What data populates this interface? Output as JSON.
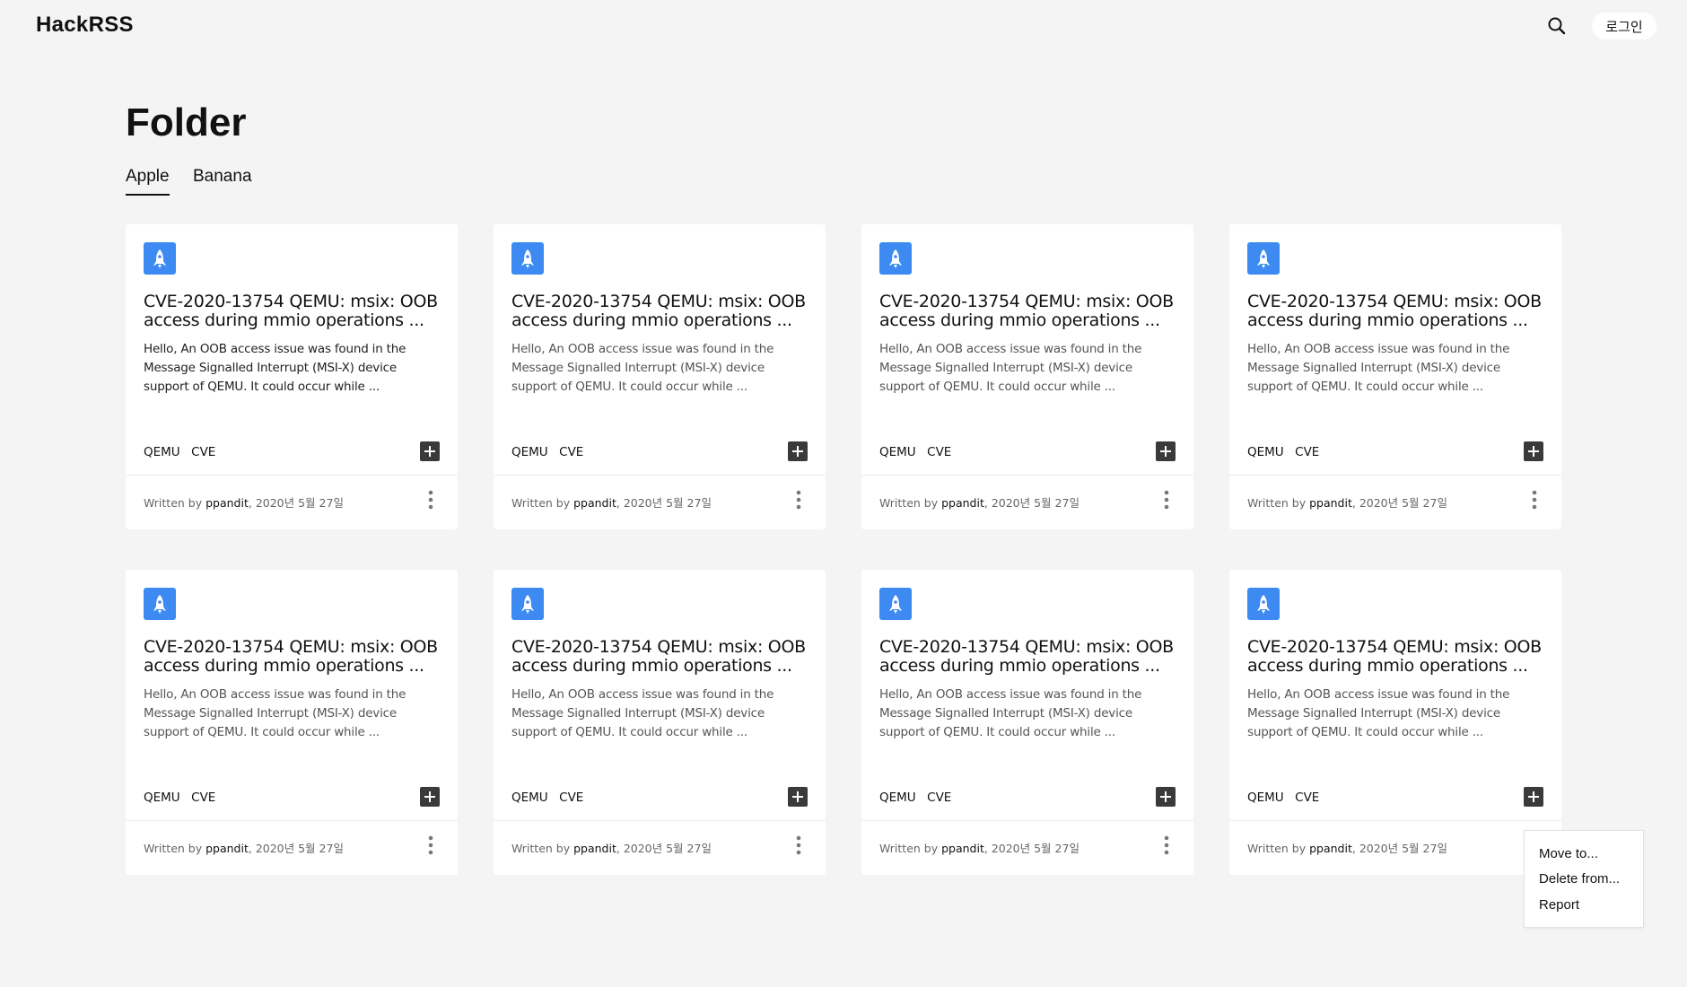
{
  "app": {
    "name": "HackRSS"
  },
  "header": {
    "login_label": "로그인"
  },
  "page": {
    "title": "Folder"
  },
  "tabs": [
    {
      "label": "Apple",
      "active": true
    },
    {
      "label": "Banana",
      "active": false
    }
  ],
  "cards": [
    {
      "title": "CVE-2020-13754 QEMU: msix: OOB access during mmio operations ...",
      "desc": "Hello, An OOB access issue was found in the Message Signalled Interrupt (MSI-X) device support of QEMU. It could occur while ...",
      "tags": [
        "QEMU",
        "CVE"
      ],
      "written_by": "Written by ",
      "author": "ppandit",
      "date": ", 2020년 5월 27일"
    },
    {
      "title": "CVE-2020-13754 QEMU: msix: OOB access during mmio operations ...",
      "desc": "Hello, An OOB access issue was found in the Message Signalled Interrupt (MSI-X) device support of QEMU. It could occur while ...",
      "tags": [
        "QEMU",
        "CVE"
      ],
      "written_by": "Written by ",
      "author": "ppandit",
      "date": ", 2020년 5월 27일"
    },
    {
      "title": "CVE-2020-13754 QEMU: msix: OOB access during mmio operations ...",
      "desc": "Hello, An OOB access issue was found in the Message Signalled Interrupt (MSI-X) device support of QEMU. It could occur while ...",
      "tags": [
        "QEMU",
        "CVE"
      ],
      "written_by": "Written by ",
      "author": "ppandit",
      "date": ", 2020년 5월 27일"
    },
    {
      "title": "CVE-2020-13754 QEMU: msix: OOB access during mmio operations ...",
      "desc": "Hello, An OOB access issue was found in the Message Signalled Interrupt (MSI-X) device support of QEMU. It could occur while ...",
      "tags": [
        "QEMU",
        "CVE"
      ],
      "written_by": "Written by ",
      "author": "ppandit",
      "date": ", 2020년 5월 27일"
    },
    {
      "title": "CVE-2020-13754 QEMU: msix: OOB access during mmio operations ...",
      "desc": "Hello, An OOB access issue was found in the Message Signalled Interrupt (MSI-X) device support of QEMU. It could occur while ...",
      "tags": [
        "QEMU",
        "CVE"
      ],
      "written_by": "Written by ",
      "author": "ppandit",
      "date": ", 2020년 5월 27일"
    },
    {
      "title": "CVE-2020-13754 QEMU: msix: OOB access during mmio operations ...",
      "desc": "Hello, An OOB access issue was found in the Message Signalled Interrupt (MSI-X) device support of QEMU. It could occur while ...",
      "tags": [
        "QEMU",
        "CVE"
      ],
      "written_by": "Written by ",
      "author": "ppandit",
      "date": ", 2020년 5월 27일"
    },
    {
      "title": "CVE-2020-13754 QEMU: msix: OOB access during mmio operations ...",
      "desc": "Hello, An OOB access issue was found in the Message Signalled Interrupt (MSI-X) device support of QEMU. It could occur while ...",
      "tags": [
        "QEMU",
        "CVE"
      ],
      "written_by": "Written by ",
      "author": "ppandit",
      "date": ", 2020년 5월 27일"
    },
    {
      "title": "CVE-2020-13754 QEMU: msix: OOB access during mmio operations ...",
      "desc": "Hello, An OOB access issue was found in the Message Signalled Interrupt (MSI-X) device support of QEMU. It could occur while ...",
      "tags": [
        "QEMU",
        "CVE"
      ],
      "written_by": "Written by ",
      "author": "ppandit",
      "date": ", 2020년 5월 27일"
    }
  ],
  "context_menu": {
    "items": [
      "Move to...",
      "Delete from...",
      "Report"
    ]
  },
  "icons": {
    "card_icon": "rocket-icon",
    "add": "plus-icon",
    "more": "more-vertical-icon",
    "search": "search-icon"
  },
  "colors": {
    "background": "#f4f4f4",
    "accent": "#3c8af2",
    "add_button": "#3a3a3a"
  }
}
